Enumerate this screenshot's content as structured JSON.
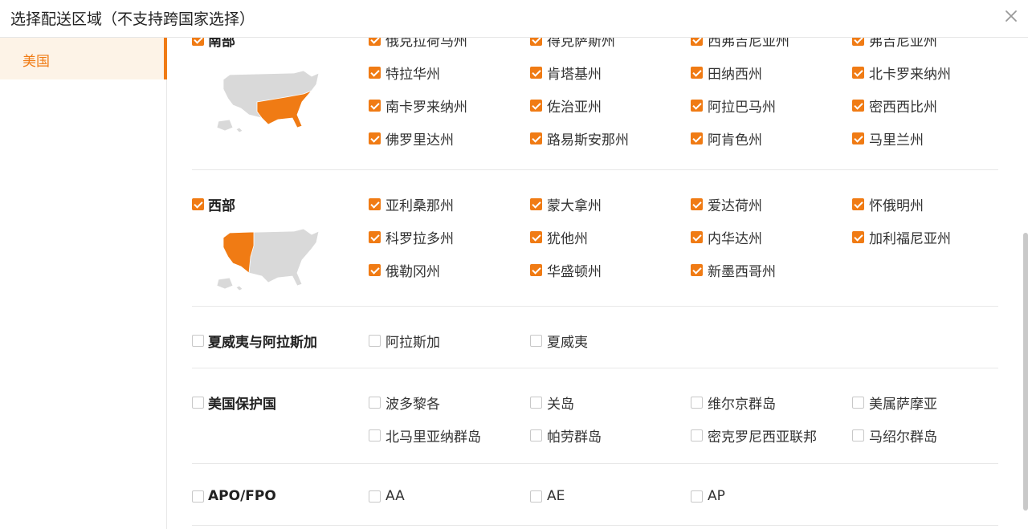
{
  "dialog": {
    "title": "选择配送区域（不支持跨国家选择）",
    "close_icon": "close-icon"
  },
  "sidebar": {
    "items": [
      {
        "label": "美国",
        "active": true
      }
    ]
  },
  "regions": [
    {
      "id": "south",
      "name": "南部",
      "checked": true,
      "map": "us-map-south-highlight",
      "states": [
        {
          "name": "俄克拉荷马州",
          "checked": true
        },
        {
          "name": "得克萨斯州",
          "checked": true
        },
        {
          "name": "西弗吉尼亚州",
          "checked": true
        },
        {
          "name": "弗吉尼亚州",
          "checked": true
        },
        {
          "name": "特拉华州",
          "checked": true
        },
        {
          "name": "肯塔基州",
          "checked": true
        },
        {
          "name": "田纳西州",
          "checked": true
        },
        {
          "name": "北卡罗来纳州",
          "checked": true
        },
        {
          "name": "南卡罗来纳州",
          "checked": true
        },
        {
          "name": "佐治亚州",
          "checked": true
        },
        {
          "name": "阿拉巴马州",
          "checked": true
        },
        {
          "name": "密西西比州",
          "checked": true
        },
        {
          "name": "佛罗里达州",
          "checked": true
        },
        {
          "name": "路易斯安那州",
          "checked": true
        },
        {
          "name": "阿肯色州",
          "checked": true
        },
        {
          "name": "马里兰州",
          "checked": true
        }
      ]
    },
    {
      "id": "west",
      "name": "西部",
      "checked": true,
      "map": "us-map-west-highlight",
      "states": [
        {
          "name": "亚利桑那州",
          "checked": true
        },
        {
          "name": "蒙大拿州",
          "checked": true
        },
        {
          "name": "爱达荷州",
          "checked": true
        },
        {
          "name": "怀俄明州",
          "checked": true
        },
        {
          "name": "科罗拉多州",
          "checked": true
        },
        {
          "name": "犹他州",
          "checked": true
        },
        {
          "name": "内华达州",
          "checked": true
        },
        {
          "name": "加利福尼亚州",
          "checked": true
        },
        {
          "name": "俄勒冈州",
          "checked": true
        },
        {
          "name": "华盛顿州",
          "checked": true
        },
        {
          "name": "新墨西哥州",
          "checked": true
        }
      ]
    },
    {
      "id": "hawaii-alaska",
      "name": "夏威夷与阿拉斯加",
      "checked": false,
      "states": [
        {
          "name": "阿拉斯加",
          "checked": false
        },
        {
          "name": "夏威夷",
          "checked": false
        }
      ]
    },
    {
      "id": "territories",
      "name": "美国保护国",
      "checked": false,
      "states": [
        {
          "name": "波多黎各",
          "checked": false
        },
        {
          "name": "关岛",
          "checked": false
        },
        {
          "name": "维尔京群岛",
          "checked": false
        },
        {
          "name": "美属萨摩亚",
          "checked": false
        },
        {
          "name": "北马里亚纳群岛",
          "checked": false
        },
        {
          "name": "帕劳群岛",
          "checked": false
        },
        {
          "name": "密克罗尼西亚联邦",
          "checked": false
        },
        {
          "name": "马绍尔群岛",
          "checked": false
        }
      ]
    },
    {
      "id": "apo-fpo",
      "name": "APO/FPO",
      "checked": false,
      "states": [
        {
          "name": "AA",
          "checked": false
        },
        {
          "name": "AE",
          "checked": false
        },
        {
          "name": "AP",
          "checked": false
        }
      ]
    }
  ],
  "colors": {
    "accent": "#f07b14",
    "active_bg": "#fdf3e7",
    "map_base": "#d9d9d9",
    "divider": "#e8e8e8"
  }
}
